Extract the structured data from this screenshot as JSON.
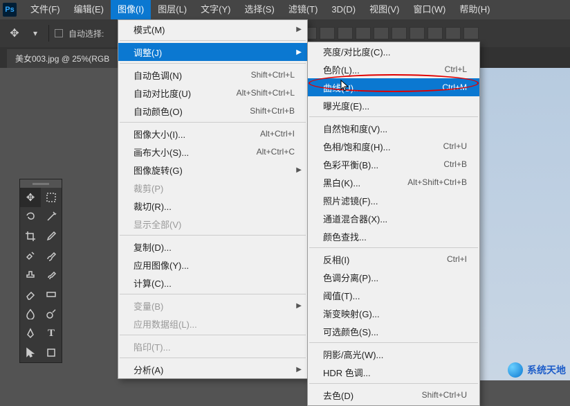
{
  "menubar": {
    "items": [
      "文件(F)",
      "编辑(E)",
      "图像(I)",
      "图层(L)",
      "文字(Y)",
      "选择(S)",
      "滤镜(T)",
      "3D(D)",
      "视图(V)",
      "窗口(W)",
      "帮助(H)"
    ],
    "open_index": 2
  },
  "optionsbar": {
    "auto_select_label": "自动选择:"
  },
  "doctab": {
    "label": "美女003.jpg @ 25%(RGB"
  },
  "image_menu": {
    "items": [
      {
        "label": "模式(M)",
        "sub": true
      },
      {
        "sep": true
      },
      {
        "label": "调整(J)",
        "sub": true,
        "highlight": true
      },
      {
        "sep": true
      },
      {
        "label": "自动色调(N)",
        "shortcut": "Shift+Ctrl+L"
      },
      {
        "label": "自动对比度(U)",
        "shortcut": "Alt+Shift+Ctrl+L"
      },
      {
        "label": "自动颜色(O)",
        "shortcut": "Shift+Ctrl+B"
      },
      {
        "sep": true
      },
      {
        "label": "图像大小(I)...",
        "shortcut": "Alt+Ctrl+I"
      },
      {
        "label": "画布大小(S)...",
        "shortcut": "Alt+Ctrl+C"
      },
      {
        "label": "图像旋转(G)",
        "sub": true
      },
      {
        "label": "裁剪(P)",
        "disabled": true
      },
      {
        "label": "裁切(R)..."
      },
      {
        "label": "显示全部(V)",
        "disabled": true
      },
      {
        "sep": true
      },
      {
        "label": "复制(D)..."
      },
      {
        "label": "应用图像(Y)..."
      },
      {
        "label": "计算(C)..."
      },
      {
        "sep": true
      },
      {
        "label": "变量(B)",
        "sub": true,
        "disabled": true
      },
      {
        "label": "应用数据组(L)...",
        "disabled": true
      },
      {
        "sep": true
      },
      {
        "label": "陷印(T)...",
        "disabled": true
      },
      {
        "sep": true
      },
      {
        "label": "分析(A)",
        "sub": true
      }
    ]
  },
  "adjust_menu": {
    "items": [
      {
        "label": "亮度/对比度(C)..."
      },
      {
        "label": "色阶(L)...",
        "shortcut": "Ctrl+L"
      },
      {
        "label": "曲线(U)...",
        "shortcut": "Ctrl+M",
        "highlight": true
      },
      {
        "label": "曝光度(E)..."
      },
      {
        "sep": true
      },
      {
        "label": "自然饱和度(V)..."
      },
      {
        "label": "色相/饱和度(H)...",
        "shortcut": "Ctrl+U"
      },
      {
        "label": "色彩平衡(B)...",
        "shortcut": "Ctrl+B"
      },
      {
        "label": "黑白(K)...",
        "shortcut": "Alt+Shift+Ctrl+B"
      },
      {
        "label": "照片滤镜(F)..."
      },
      {
        "label": "通道混合器(X)..."
      },
      {
        "label": "颜色查找..."
      },
      {
        "sep": true
      },
      {
        "label": "反相(I)",
        "shortcut": "Ctrl+I"
      },
      {
        "label": "色调分离(P)..."
      },
      {
        "label": "阈值(T)..."
      },
      {
        "label": "渐变映射(G)..."
      },
      {
        "label": "可选颜色(S)..."
      },
      {
        "sep": true
      },
      {
        "label": "阴影/高光(W)..."
      },
      {
        "label": "HDR 色调..."
      },
      {
        "sep": true
      },
      {
        "label": "去色(D)",
        "shortcut": "Shift+Ctrl+U"
      }
    ]
  },
  "watermark": {
    "text": "系统天地"
  },
  "logo": {
    "text": "Ps"
  }
}
